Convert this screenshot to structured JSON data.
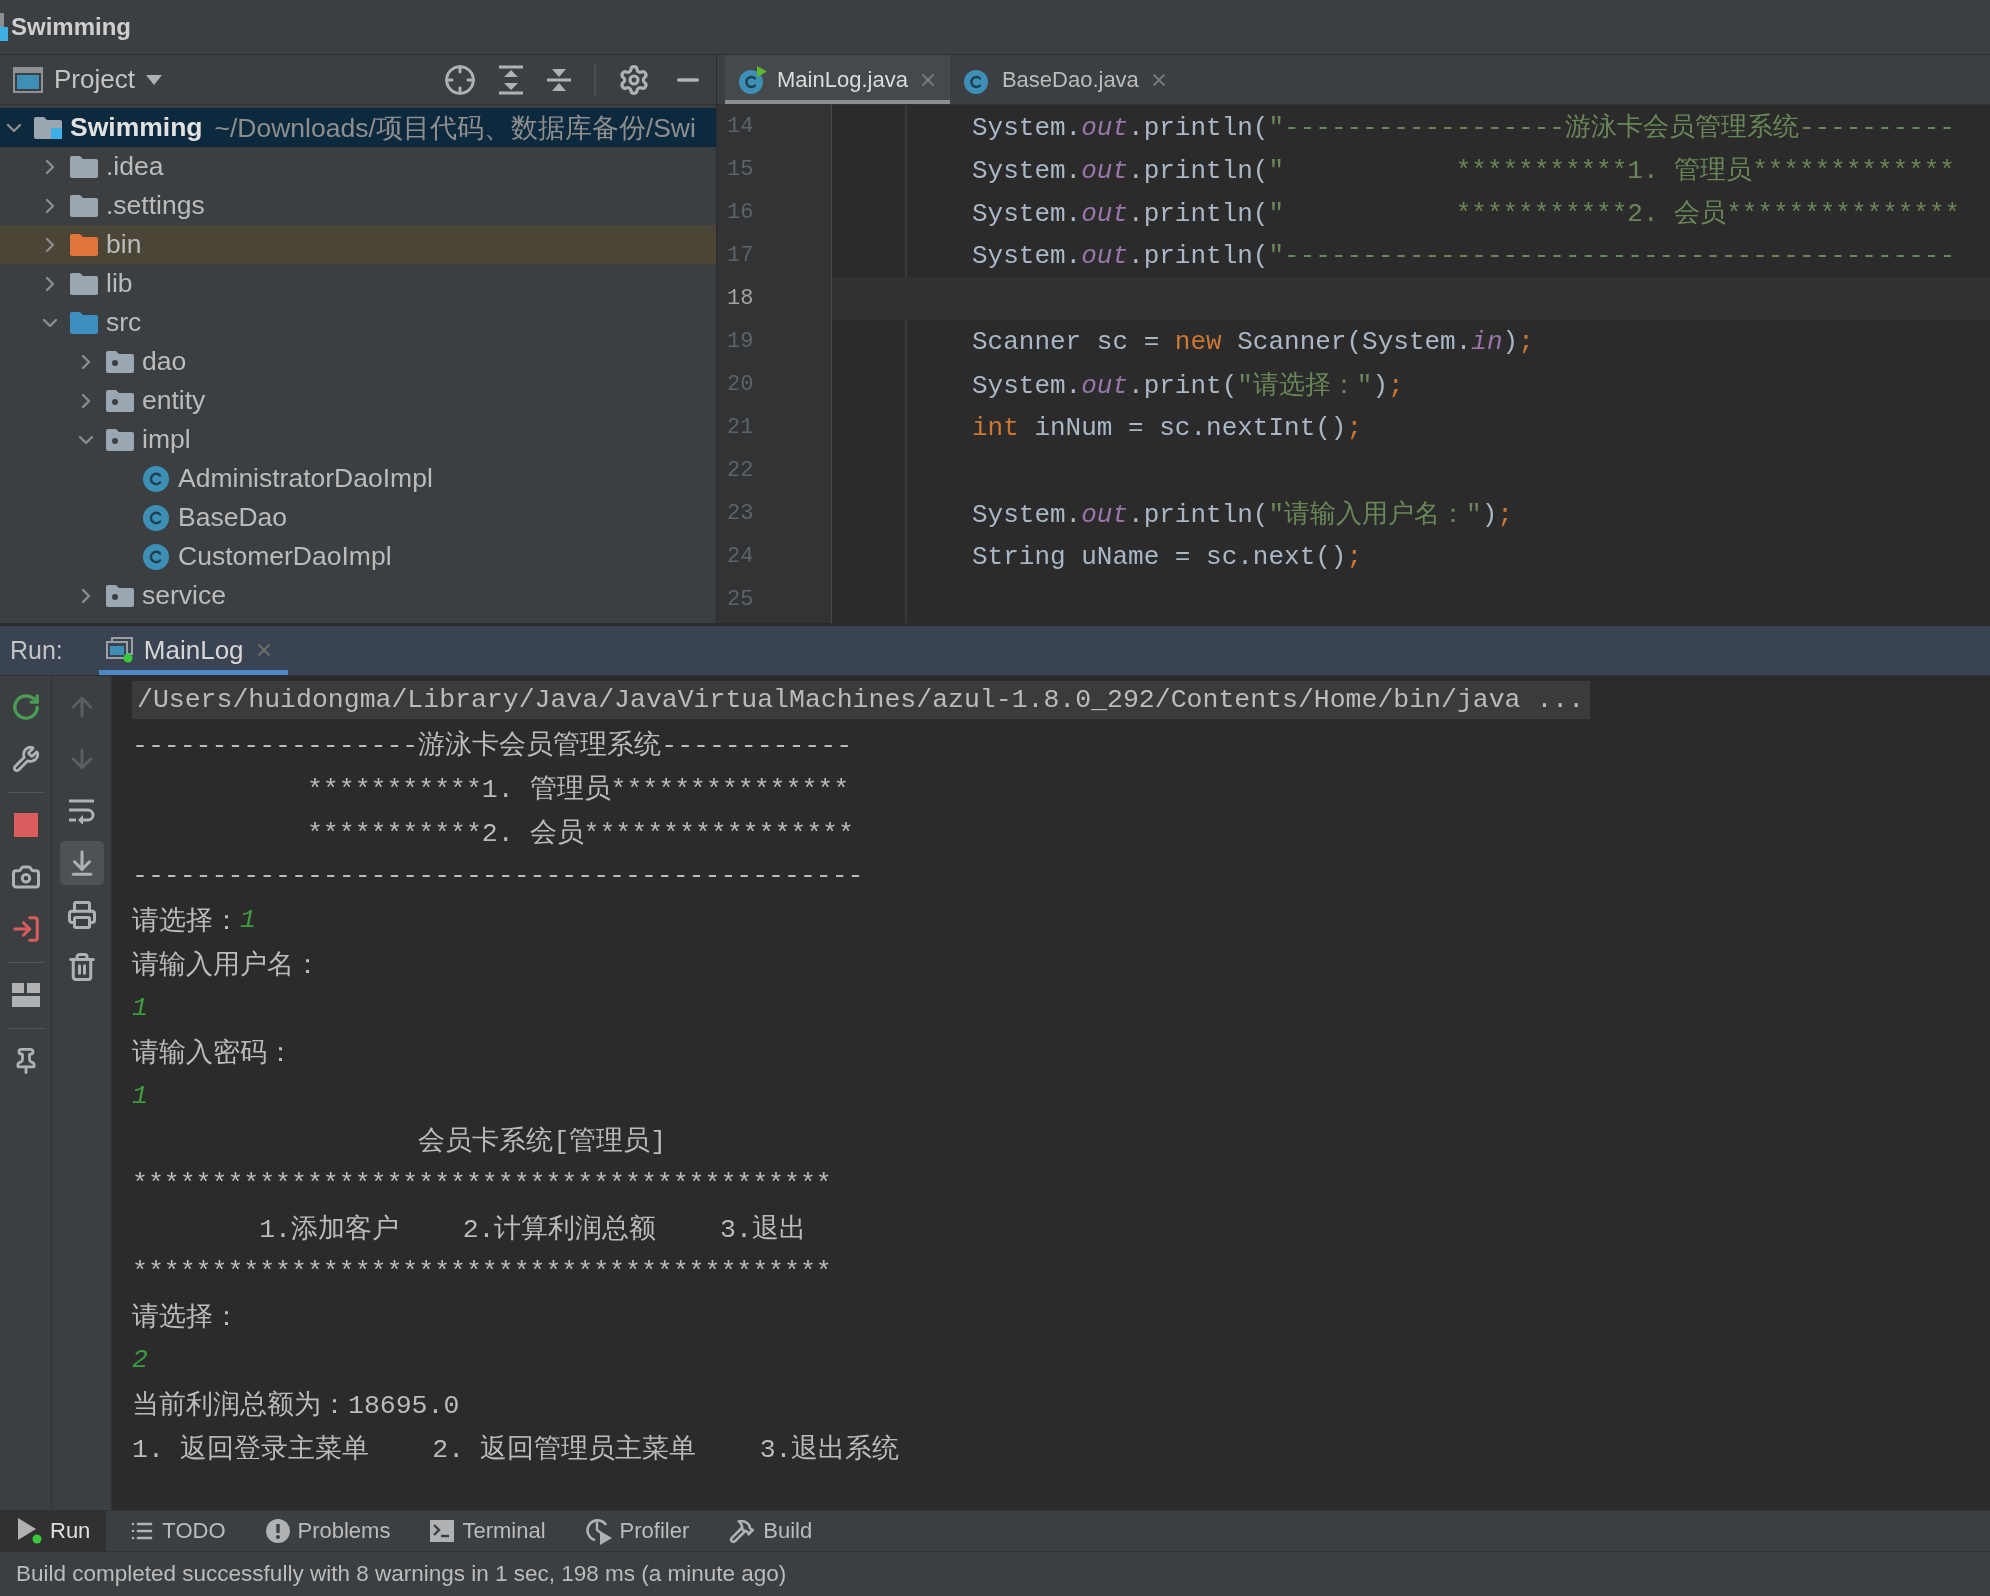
{
  "window": {
    "title": "Swimming"
  },
  "project_panel": {
    "title": "Project",
    "tree": [
      {
        "label": "Swimming",
        "path": "~/Downloads/项目代码、数据库备份/Swi",
        "kind": "module",
        "expanded": true,
        "selected": true,
        "children": [
          {
            "label": ".idea",
            "kind": "folder",
            "expanded": false,
            "selected": false
          },
          {
            "label": ".settings",
            "kind": "folder",
            "expanded": false,
            "selected": false
          },
          {
            "label": "bin",
            "kind": "excluded",
            "expanded": false,
            "selected": false
          },
          {
            "label": "lib",
            "kind": "folder",
            "expanded": false,
            "selected": false
          },
          {
            "label": "src",
            "kind": "source",
            "expanded": true,
            "selected": false,
            "children": [
              {
                "label": "dao",
                "kind": "package",
                "expanded": false,
                "selected": false
              },
              {
                "label": "entity",
                "kind": "package",
                "expanded": false,
                "selected": false
              },
              {
                "label": "impl",
                "kind": "package",
                "expanded": true,
                "selected": false,
                "children": [
                  {
                    "label": "AdministratorDaoImpl",
                    "kind": "class",
                    "selected": false
                  },
                  {
                    "label": "BaseDao",
                    "kind": "class",
                    "selected": false
                  },
                  {
                    "label": "CustomerDaoImpl",
                    "kind": "class",
                    "selected": false
                  }
                ]
              },
              {
                "label": "service",
                "kind": "package",
                "expanded": false,
                "selected": false
              }
            ]
          }
        ]
      }
    ]
  },
  "editor": {
    "tabs": [
      {
        "label": "MainLog.java",
        "selected": true,
        "runnable": true
      },
      {
        "label": "BaseDao.java",
        "selected": false,
        "runnable": false
      }
    ],
    "lines": [
      {
        "number": "14",
        "current": false,
        "tokens": [
          {
            "text": "System.",
            "kind": "plain"
          },
          {
            "text": "out",
            "kind": "field"
          },
          {
            "text": ".println(",
            "kind": "plain"
          },
          {
            "text": "\"------------------游泳卡会员管理系统----------",
            "kind": "string"
          }
        ]
      },
      {
        "number": "15",
        "current": false,
        "tokens": [
          {
            "text": "System.",
            "kind": "plain"
          },
          {
            "text": "out",
            "kind": "field"
          },
          {
            "text": ".println(",
            "kind": "plain"
          },
          {
            "text": "\"           ***********1. 管理员*************",
            "kind": "string"
          }
        ]
      },
      {
        "number": "16",
        "current": false,
        "tokens": [
          {
            "text": "System.",
            "kind": "plain"
          },
          {
            "text": "out",
            "kind": "field"
          },
          {
            "text": ".println(",
            "kind": "plain"
          },
          {
            "text": "\"           ***********2. 会员***************",
            "kind": "string"
          }
        ]
      },
      {
        "number": "17",
        "current": false,
        "tokens": [
          {
            "text": "System.",
            "kind": "plain"
          },
          {
            "text": "out",
            "kind": "field"
          },
          {
            "text": ".println(",
            "kind": "plain"
          },
          {
            "text": "\"-------------------------------------------",
            "kind": "string"
          }
        ]
      },
      {
        "number": "18",
        "current": true
      },
      {
        "number": "19",
        "current": false,
        "tokens": [
          {
            "text": "Scanner sc = ",
            "kind": "plain"
          },
          {
            "text": "new",
            "kind": "keyword"
          },
          {
            "text": " Scanner(System.",
            "kind": "plain"
          },
          {
            "text": "in",
            "kind": "field"
          },
          {
            "text": ")",
            "kind": "plain"
          },
          {
            "text": ";",
            "kind": "keyword"
          }
        ]
      },
      {
        "number": "20",
        "current": false,
        "tokens": [
          {
            "text": "System.",
            "kind": "plain"
          },
          {
            "text": "out",
            "kind": "field"
          },
          {
            "text": ".print(",
            "kind": "plain"
          },
          {
            "text": "\"请选择：\"",
            "kind": "string"
          },
          {
            "text": ")",
            "kind": "plain"
          },
          {
            "text": ";",
            "kind": "keyword"
          }
        ]
      },
      {
        "number": "21",
        "current": false,
        "tokens": [
          {
            "text": "int",
            "kind": "keyword"
          },
          {
            "text": " inNum = sc.nextInt()",
            "kind": "plain"
          },
          {
            "text": ";",
            "kind": "keyword"
          }
        ]
      },
      {
        "number": "22",
        "current": false
      },
      {
        "number": "23",
        "current": false,
        "tokens": [
          {
            "text": "System.",
            "kind": "plain"
          },
          {
            "text": "out",
            "kind": "field"
          },
          {
            "text": ".println(",
            "kind": "plain"
          },
          {
            "text": "\"请输入用户名：\"",
            "kind": "string"
          },
          {
            "text": ")",
            "kind": "plain"
          },
          {
            "text": ";",
            "kind": "keyword"
          }
        ]
      },
      {
        "number": "24",
        "current": false,
        "tokens": [
          {
            "text": "String uName = sc.next()",
            "kind": "plain"
          },
          {
            "text": ";",
            "kind": "keyword"
          }
        ]
      },
      {
        "number": "25",
        "current": false
      }
    ]
  },
  "run_panel": {
    "label": "Run:",
    "tabs": [
      {
        "label": "MainLog",
        "selected": true
      }
    ],
    "console_actions": [
      {
        "disabled": true,
        "on": false
      },
      {
        "disabled": true,
        "on": false
      },
      {
        "disabled": false,
        "on": false
      },
      {
        "disabled": false,
        "on": true
      },
      {
        "disabled": false,
        "on": false
      },
      {
        "disabled": false,
        "on": false
      }
    ],
    "console": [
      {
        "segments": [
          {
            "text": "/Users/huidongma/Library/Java/JavaVirtualMachines/azul-1.8.0_292/Contents/Home/bin/java ...",
            "kind": "command"
          }
        ]
      },
      {
        "segments": [
          {
            "text": "------------------游泳卡会员管理系统------------",
            "kind": "output"
          }
        ]
      },
      {
        "segments": [
          {
            "text": "           ***********1. 管理员***************",
            "kind": "output"
          }
        ]
      },
      {
        "segments": [
          {
            "text": "           ***********2. 会员*****************",
            "kind": "output"
          }
        ]
      },
      {
        "segments": [
          {
            "text": "----------------------------------------------",
            "kind": "output"
          }
        ]
      },
      {
        "segments": [
          {
            "text": "请选择：",
            "kind": "output"
          },
          {
            "text": "1",
            "kind": "input"
          }
        ]
      },
      {
        "segments": [
          {
            "text": "请输入用户名：",
            "kind": "output"
          }
        ]
      },
      {
        "segments": [
          {
            "text": "1",
            "kind": "input"
          }
        ]
      },
      {
        "segments": [
          {
            "text": "请输入密码：",
            "kind": "output"
          }
        ]
      },
      {
        "segments": [
          {
            "text": "1",
            "kind": "input"
          }
        ]
      },
      {
        "segments": [
          {
            "text": "                  会员卡系统[管理员]",
            "kind": "output"
          }
        ]
      },
      {
        "segments": [
          {
            "text": "********************************************",
            "kind": "output"
          }
        ]
      },
      {
        "segments": [
          {
            "text": "        1.添加客户    2.计算利润总额    3.退出",
            "kind": "output"
          }
        ]
      },
      {
        "segments": [
          {
            "text": "********************************************",
            "kind": "output"
          }
        ]
      },
      {
        "segments": [
          {
            "text": "请选择：",
            "kind": "output"
          }
        ]
      },
      {
        "segments": [
          {
            "text": "2",
            "kind": "input"
          }
        ]
      },
      {
        "segments": [
          {
            "text": "当前利润总额为：18695.0",
            "kind": "output"
          }
        ]
      },
      {
        "segments": [
          {
            "text": "1. 返回登录主菜单    2. 返回管理员主菜单    3.退出系统",
            "kind": "output"
          }
        ]
      }
    ]
  },
  "tool_windows": [
    {
      "label": "Run",
      "selected": true
    },
    {
      "label": "TODO",
      "selected": false
    },
    {
      "label": "Problems",
      "selected": false
    },
    {
      "label": "Terminal",
      "selected": false
    },
    {
      "label": "Profiler",
      "selected": false
    },
    {
      "label": "Build",
      "selected": false
    }
  ],
  "status_bar": {
    "message": "Build completed successfully with 8 warnings in 1 sec, 198 ms (a minute ago)"
  }
}
